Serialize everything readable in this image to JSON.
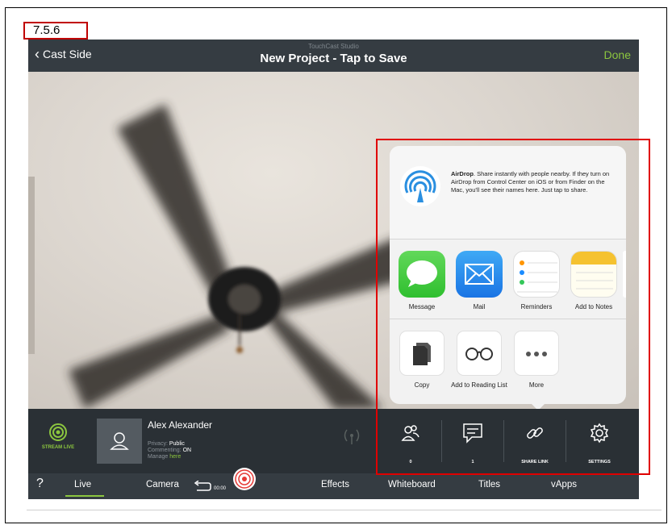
{
  "figure_label": "7.5.6",
  "topbar": {
    "back_label": "Cast Side",
    "studio_label": "TouchCast Studio",
    "project_title": "New Project - Tap to Save",
    "done_label": "Done"
  },
  "share_sheet": {
    "airdrop_title": "AirDrop",
    "airdrop_text": ". Share instantly with people nearby. If they turn on AirDrop from Control Center on iOS or from Finder on the Mac, you'll see their names here. Just tap to share.",
    "apps": [
      {
        "label": "Message",
        "icon": "messages-icon"
      },
      {
        "label": "Mail",
        "icon": "mail-icon"
      },
      {
        "label": "Reminders",
        "icon": "reminders-icon"
      },
      {
        "label": "Add to Notes",
        "icon": "notes-icon"
      }
    ],
    "actions": [
      {
        "label": "Copy",
        "icon": "copy-icon"
      },
      {
        "label": "Add to Reading List",
        "icon": "reading-list-icon"
      },
      {
        "label": "More",
        "icon": "more-icon"
      }
    ]
  },
  "bottom_panel": {
    "stream_label": "STREAM LIVE",
    "user_name": "Alex Alexander",
    "privacy_label": "Privacy:",
    "privacy_value": "Public",
    "commenting_label": "Commenting:",
    "commenting_value": "ON",
    "manage_label": "Manage",
    "manage_link": "here",
    "buttons": [
      {
        "label": "0",
        "icon": "viewers-icon"
      },
      {
        "label": "1",
        "icon": "comments-icon"
      },
      {
        "label": "SHARE LINK",
        "icon": "link-icon"
      },
      {
        "label": "SETTINGS",
        "icon": "gear-icon"
      }
    ]
  },
  "tabbar": {
    "help": "?",
    "tabs": [
      "Live",
      "Camera",
      "Effects",
      "Whiteboard",
      "Titles",
      "vApps"
    ],
    "active_tab": "Live",
    "timer": "00:00"
  },
  "colors": {
    "accent_green": "#8cc63f",
    "highlight_red": "#e00000",
    "record_red": "#e53935"
  }
}
